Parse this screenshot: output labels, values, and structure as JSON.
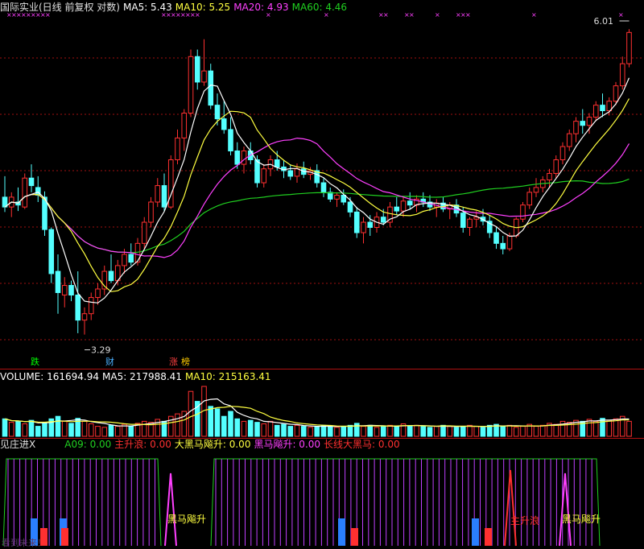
{
  "header": {
    "title": "国际实业(日线 前复权 对数)",
    "ma5": "MA5: 5.43",
    "ma10": "MA10: 5.25",
    "ma20": "MA20: 4.93",
    "ma60": "MA60: 4.46"
  },
  "price_labels": {
    "high": "6.01",
    "low": "3.29"
  },
  "event_marks": {
    "die": "跌",
    "cai": "财",
    "zhang": "涨",
    "bang": "榜"
  },
  "volume_header": {
    "volume": "VOLUME: 161694.94",
    "ma5": "MA5: 217988.41",
    "ma10": "MA10: 215163.41"
  },
  "indicator_header": {
    "name": "见庄进X",
    "a09": "A09: 0.00",
    "zhushenglang": "主升浪: 0.00",
    "dahei": "大黑马飚升: 0.00",
    "heima": "黑马飚升: 0.00",
    "changxian": "长线大黑马: 0.00"
  },
  "indicator_labels": {
    "heima1": "黑马飚升",
    "zhushenglang": "主升浪",
    "heima2": "黑马飚升",
    "watermark": "看到未来！"
  },
  "colors": {
    "up": "#ff3030",
    "down": "#54ffff",
    "ma5": "#ffffff",
    "ma10": "#ffff40",
    "ma20": "#ff40ff",
    "ma60": "#20d020",
    "grid": "#a01010",
    "blue": "#2a7fff"
  },
  "chart_data": {
    "type": "candlestick",
    "scale": "log",
    "ohlc": [
      [
        4.5,
        4.72,
        4.35,
        4.4
      ],
      [
        4.4,
        4.55,
        4.3,
        4.5
      ],
      [
        4.45,
        4.6,
        4.36,
        4.42
      ],
      [
        4.4,
        4.75,
        4.38,
        4.7
      ],
      [
        4.7,
        4.85,
        4.55,
        4.62
      ],
      [
        4.6,
        4.72,
        4.45,
        4.52
      ],
      [
        4.5,
        4.56,
        4.12,
        4.18
      ],
      [
        4.18,
        4.2,
        3.7,
        3.78
      ],
      [
        3.8,
        3.95,
        3.45,
        3.62
      ],
      [
        3.6,
        3.75,
        3.5,
        3.68
      ],
      [
        3.68,
        3.72,
        3.55,
        3.6
      ],
      [
        3.6,
        3.8,
        3.3,
        3.4
      ],
      [
        3.4,
        3.5,
        3.29,
        3.45
      ],
      [
        3.45,
        3.62,
        3.4,
        3.58
      ],
      [
        3.58,
        3.7,
        3.52,
        3.65
      ],
      [
        3.65,
        3.85,
        3.6,
        3.8
      ],
      [
        3.8,
        3.95,
        3.7,
        3.72
      ],
      [
        3.72,
        3.9,
        3.68,
        3.85
      ],
      [
        3.85,
        4.0,
        3.78,
        3.95
      ],
      [
        3.95,
        4.05,
        3.85,
        3.88
      ],
      [
        3.88,
        4.1,
        3.85,
        4.05
      ],
      [
        4.05,
        4.3,
        4.0,
        4.25
      ],
      [
        4.25,
        4.5,
        4.2,
        4.45
      ],
      [
        4.45,
        4.7,
        4.4,
        4.62
      ],
      [
        4.62,
        4.75,
        4.35,
        4.4
      ],
      [
        4.4,
        4.95,
        4.38,
        4.9
      ],
      [
        4.9,
        5.25,
        4.85,
        5.15
      ],
      [
        5.15,
        5.5,
        5.0,
        5.45
      ],
      [
        5.45,
        6.3,
        5.4,
        6.2
      ],
      [
        6.2,
        6.3,
        5.75,
        5.85
      ],
      [
        5.85,
        6.45,
        5.8,
        6.0
      ],
      [
        6.0,
        6.1,
        5.5,
        5.55
      ],
      [
        5.55,
        5.7,
        5.3,
        5.38
      ],
      [
        5.38,
        5.6,
        5.2,
        5.25
      ],
      [
        5.25,
        5.4,
        4.95,
        5.0
      ],
      [
        5.0,
        5.1,
        4.8,
        4.85
      ],
      [
        4.85,
        5.05,
        4.75,
        5.0
      ],
      [
        5.0,
        5.1,
        4.85,
        4.9
      ],
      [
        4.9,
        4.95,
        4.6,
        4.65
      ],
      [
        4.65,
        4.85,
        4.6,
        4.8
      ],
      [
        4.8,
        4.95,
        4.72,
        4.9
      ],
      [
        4.9,
        5.0,
        4.78,
        4.82
      ],
      [
        4.82,
        4.9,
        4.7,
        4.78
      ],
      [
        4.78,
        4.85,
        4.68,
        4.72
      ],
      [
        4.72,
        4.86,
        4.65,
        4.8
      ],
      [
        4.8,
        4.88,
        4.7,
        4.74
      ],
      [
        4.74,
        4.82,
        4.68,
        4.78
      ],
      [
        4.78,
        4.85,
        4.6,
        4.65
      ],
      [
        4.65,
        4.7,
        4.5,
        4.55
      ],
      [
        4.55,
        4.6,
        4.45,
        4.48
      ],
      [
        4.48,
        4.55,
        4.4,
        4.52
      ],
      [
        4.52,
        4.58,
        4.42,
        4.45
      ],
      [
        4.45,
        4.5,
        4.3,
        4.35
      ],
      [
        4.35,
        4.4,
        4.1,
        4.15
      ],
      [
        4.15,
        4.3,
        4.05,
        4.25
      ],
      [
        4.25,
        4.32,
        4.12,
        4.2
      ],
      [
        4.2,
        4.35,
        4.15,
        4.3
      ],
      [
        4.3,
        4.38,
        4.22,
        4.25
      ],
      [
        4.25,
        4.45,
        4.2,
        4.4
      ],
      [
        4.4,
        4.5,
        4.32,
        4.36
      ],
      [
        4.36,
        4.5,
        4.3,
        4.46
      ],
      [
        4.46,
        4.55,
        4.38,
        4.42
      ],
      [
        4.42,
        4.52,
        4.35,
        4.48
      ],
      [
        4.48,
        4.55,
        4.4,
        4.45
      ],
      [
        4.45,
        4.52,
        4.36,
        4.4
      ],
      [
        4.4,
        4.48,
        4.3,
        4.44
      ],
      [
        4.44,
        4.5,
        4.35,
        4.38
      ],
      [
        4.38,
        4.45,
        4.28,
        4.42
      ],
      [
        4.42,
        4.48,
        4.3,
        4.34
      ],
      [
        4.34,
        4.4,
        4.15,
        4.2
      ],
      [
        4.2,
        4.3,
        4.12,
        4.28
      ],
      [
        4.28,
        4.36,
        4.2,
        4.3
      ],
      [
        4.3,
        4.38,
        4.22,
        4.26
      ],
      [
        4.26,
        4.32,
        4.1,
        4.15
      ],
      [
        4.15,
        4.2,
        4.0,
        4.05
      ],
      [
        4.05,
        4.12,
        3.95,
        4.0
      ],
      [
        4.0,
        4.15,
        3.98,
        4.12
      ],
      [
        4.12,
        4.3,
        4.1,
        4.28
      ],
      [
        4.28,
        4.45,
        4.25,
        4.42
      ],
      [
        4.42,
        4.6,
        4.38,
        4.55
      ],
      [
        4.55,
        4.7,
        4.5,
        4.6
      ],
      [
        4.6,
        4.72,
        4.55,
        4.68
      ],
      [
        4.68,
        4.8,
        4.6,
        4.75
      ],
      [
        4.75,
        4.95,
        4.7,
        4.9
      ],
      [
        4.9,
        5.1,
        4.85,
        5.05
      ],
      [
        5.05,
        5.25,
        5.0,
        5.2
      ],
      [
        5.2,
        5.4,
        5.1,
        5.35
      ],
      [
        5.35,
        5.5,
        5.2,
        5.3
      ],
      [
        5.3,
        5.45,
        5.2,
        5.4
      ],
      [
        5.4,
        5.6,
        5.35,
        5.55
      ],
      [
        5.55,
        5.7,
        5.4,
        5.48
      ],
      [
        5.48,
        5.65,
        5.42,
        5.6
      ],
      [
        5.6,
        5.85,
        5.55,
        5.8
      ],
      [
        5.8,
        6.2,
        5.75,
        6.1
      ],
      [
        6.1,
        6.6,
        6.05,
        6.55
      ]
    ],
    "volume": [
      0.35,
      0.28,
      0.3,
      0.25,
      0.32,
      0.2,
      0.28,
      0.35,
      0.4,
      0.3,
      0.26,
      0.36,
      0.3,
      0.25,
      0.2,
      0.18,
      0.22,
      0.2,
      0.24,
      0.2,
      0.26,
      0.3,
      0.28,
      0.34,
      0.3,
      0.4,
      0.45,
      0.5,
      0.9,
      0.7,
      1.0,
      0.6,
      0.55,
      0.4,
      0.5,
      0.35,
      0.3,
      0.32,
      0.28,
      0.25,
      0.3,
      0.22,
      0.24,
      0.2,
      0.22,
      0.2,
      0.18,
      0.2,
      0.22,
      0.2,
      0.18,
      0.2,
      0.22,
      0.26,
      0.2,
      0.22,
      0.18,
      0.2,
      0.22,
      0.2,
      0.25,
      0.2,
      0.22,
      0.2,
      0.18,
      0.2,
      0.22,
      0.2,
      0.18,
      0.2,
      0.22,
      0.2,
      0.18,
      0.22,
      0.24,
      0.2,
      0.22,
      0.18,
      0.2,
      0.24,
      0.2,
      0.22,
      0.26,
      0.24,
      0.3,
      0.28,
      0.32,
      0.3,
      0.34,
      0.3,
      0.36,
      0.32,
      0.35,
      0.4,
      0.3
    ]
  }
}
